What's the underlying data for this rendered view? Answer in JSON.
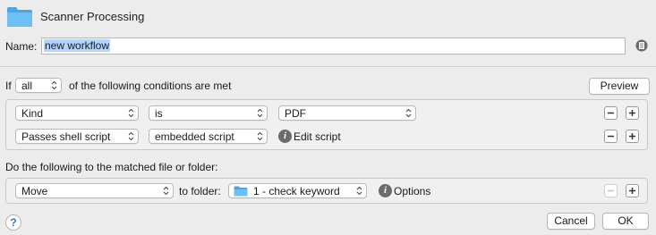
{
  "header": {
    "title": "Scanner Processing"
  },
  "name": {
    "label": "Name:",
    "value": "new workflow"
  },
  "conditions": {
    "prefix": "If",
    "match_mode": "all",
    "suffix": "of the following conditions are met",
    "preview_label": "Preview",
    "rows": [
      {
        "attribute": "Kind",
        "operator": "is",
        "value": "PDF"
      },
      {
        "attribute": "Passes shell script",
        "operator": "embedded script",
        "action_label": "Edit script"
      }
    ]
  },
  "actions": {
    "heading": "Do the following to the matched file or folder:",
    "rows": [
      {
        "action": "Move",
        "target_label": "to folder:",
        "folder": "1 - check keyword",
        "options_label": "Options"
      }
    ]
  },
  "footer": {
    "help": "?",
    "cancel_label": "Cancel",
    "ok_label": "OK"
  },
  "colors": {
    "folder_blue": "#5fb3ee",
    "selection": "#b4d5fe",
    "help_blue": "#2a76d2"
  },
  "icons": [
    "folder-icon",
    "notes-icon",
    "chevron-updown-icon",
    "minus-icon",
    "plus-icon",
    "info-icon",
    "help-icon"
  ]
}
